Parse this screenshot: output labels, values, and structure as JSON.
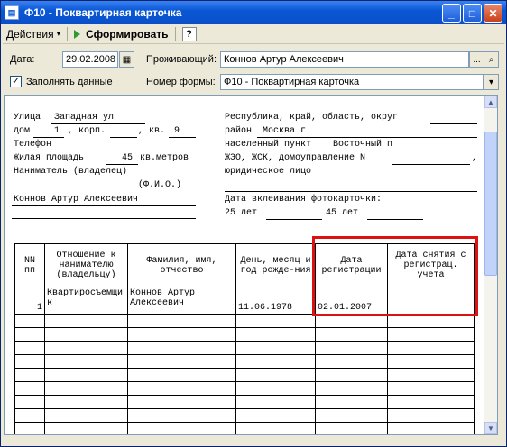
{
  "window": {
    "title": "Ф10 - Поквартирная карточка",
    "icon": "form-icon",
    "minimize": "_",
    "maximize": "□",
    "close": "✕"
  },
  "toolbar": {
    "actions": "Действия",
    "actions_arrow": "▾",
    "generate": "Сформировать",
    "help": "?"
  },
  "filters": {
    "date_label": "Дата:",
    "date_value": "29.02.2008",
    "resident_label": "Проживающий:",
    "resident_value": "Коннов Артур Алексеевич",
    "fill_label": "Заполнять данные",
    "fill_checked": "✓",
    "form_label": "Номер формы:",
    "form_value": "Ф10 - Поквартирная карточка",
    "ellipsis": "...",
    "search_icon": "⌕",
    "dropdown": "▾",
    "calendar_icon": "▦"
  },
  "card": {
    "street_label": "Улица",
    "street": "Западная ул",
    "house_label": "дом",
    "house": "1",
    "corp_label": ", корп.",
    "corp": "",
    "apt_label": ", кв.",
    "apt": "9",
    "phone_label": "Телефон",
    "area_label": "Жилая площадь",
    "area": "45",
    "area_unit": "кв.метров",
    "owner_label": "Наниматель (владелец)",
    "fio_note": "(Ф.И.О.)",
    "owner_name": "Коннов Артур Алексеевич",
    "region_label": "Республика, край, область, округ",
    "district_label": "район",
    "district": "Москва г",
    "locality_label": "населенный пункт",
    "locality": "Восточный п",
    "housing_label": "ЖЭО, ЖСК, домоуправление N",
    "housing_comma": ",",
    "legal_label": "юридическое лицо",
    "photo_label": "Дата вклеивания фотокарточки:",
    "age25": "25 лет",
    "age45": "45 лет"
  },
  "table": {
    "headers": [
      "NN пп",
      "Отношение к нанимателю (владельцу)",
      "Фамилия, имя, отчество",
      "День, месяц и год рожде-ния",
      "Дата регистрации",
      "Дата снятия с регистрац. учета"
    ],
    "rows": [
      [
        "1",
        "Квартиросъемщик",
        "Коннов Артур Алексеевич",
        "11.06.1978",
        "02.01.2007",
        ""
      ]
    ]
  }
}
